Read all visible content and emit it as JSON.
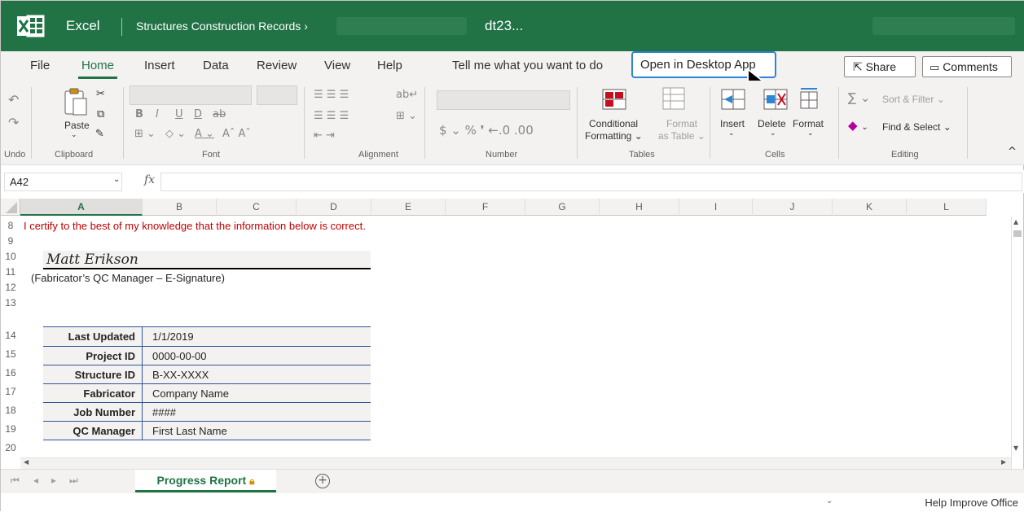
{
  "title_bar": {
    "app_name": "Excel",
    "breadcrumb": "Structures Construction Records ›",
    "document_name": "dt23..."
  },
  "tabs": [
    {
      "label": "File"
    },
    {
      "label": "Home",
      "active": true
    },
    {
      "label": "Insert"
    },
    {
      "label": "Data"
    },
    {
      "label": "Review"
    },
    {
      "label": "View"
    },
    {
      "label": "Help"
    }
  ],
  "tell_me": "Tell me what you want to do",
  "open_desktop": "Open in Desktop App",
  "share": "Share",
  "comments": "Comments",
  "ribbon": {
    "undo_group": "Undo",
    "paste": "Paste",
    "clipboard_group": "Clipboard",
    "font_group": "Font",
    "alignment_group": "Alignment",
    "number_group": "Number",
    "conditional_1": "Conditional",
    "conditional_2": "Formatting",
    "format_table_1": "Format",
    "format_table_2": "as Table",
    "tables_group": "Tables",
    "insert": "Insert",
    "delete": "Delete",
    "format": "Format",
    "cells_group": "Cells",
    "sort_filter": "Sort & Filter",
    "find_select": "Find & Select",
    "editing_group": "Editing"
  },
  "formula_bar": {
    "name_box": "A42",
    "fx": "fx",
    "value": ""
  },
  "columns": [
    "A",
    "B",
    "C",
    "D",
    "E",
    "F",
    "G",
    "H",
    "I",
    "J",
    "K",
    "L"
  ],
  "rows": [
    "8",
    "9",
    "10",
    "11",
    "12",
    "13",
    "14",
    "15",
    "16",
    "17",
    "18",
    "19",
    "20"
  ],
  "sheet": {
    "certify_text": "I certify to the best of my knowledge that the information below is correct.",
    "signature": "Matt Erikson",
    "signature_caption": "(Fabricator’s QC Manager – E-Signature)",
    "table": [
      {
        "label": "Last Updated",
        "value": "1/1/2019"
      },
      {
        "label": "Project ID",
        "value": "0000-00-00"
      },
      {
        "label": "Structure ID",
        "value": "B-XX-XXXX"
      },
      {
        "label": "Fabricator",
        "value": "Company Name"
      },
      {
        "label": "Job Number",
        "value": "####"
      },
      {
        "label": "QC Manager",
        "value": "First Last Name"
      }
    ]
  },
  "sheet_tab": "Progress Report",
  "status": {
    "help_improve": "Help Improve Office"
  },
  "colors": {
    "excel_green": "#217346",
    "certify_red": "#c00000",
    "table_border": "#2f5597"
  }
}
